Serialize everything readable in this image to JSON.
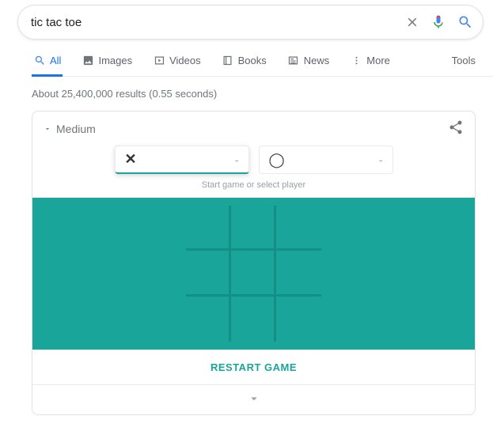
{
  "search": {
    "query": "tic tac toe"
  },
  "tabs": {
    "all": "All",
    "images": "Images",
    "videos": "Videos",
    "books": "Books",
    "news": "News",
    "more": "More",
    "tools": "Tools"
  },
  "results": {
    "stats": "About 25,400,000 results (0.55 seconds)"
  },
  "game": {
    "difficulty": "Medium",
    "player_x": {
      "symbol": "✕",
      "score": "-"
    },
    "player_o": {
      "symbol": "◯",
      "score": "-"
    },
    "hint": "Start game or select player",
    "restart": "RESTART GAME"
  }
}
